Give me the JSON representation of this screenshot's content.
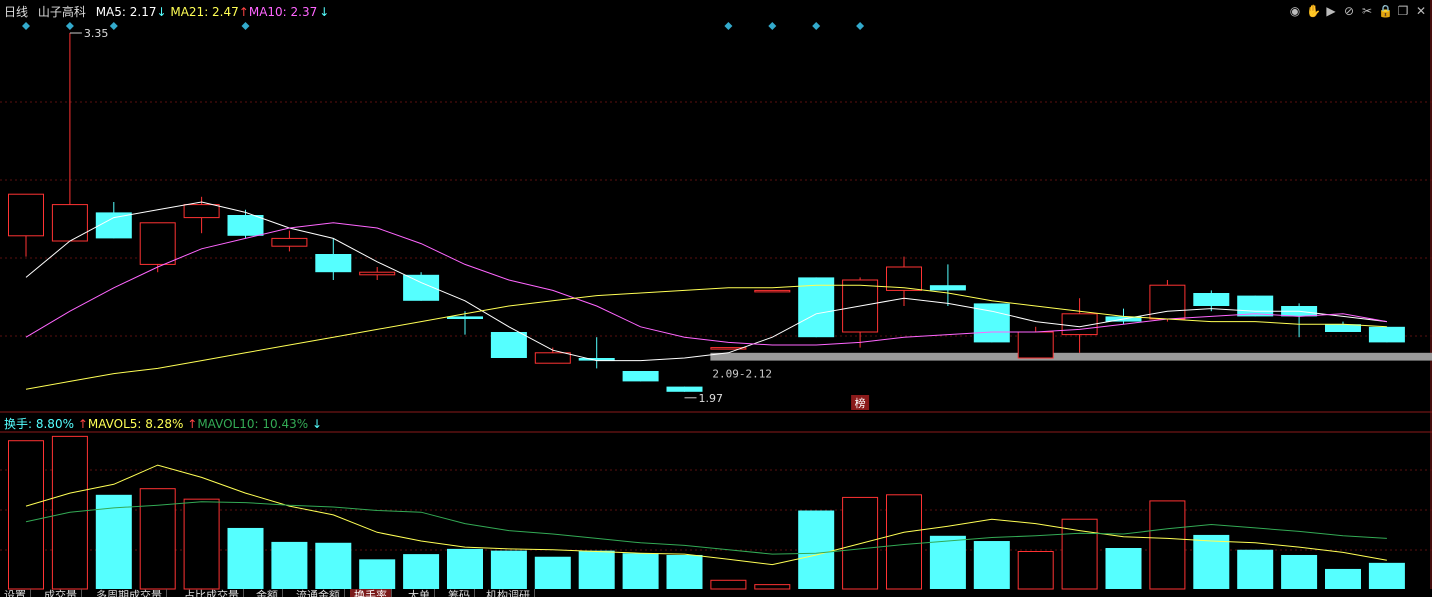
{
  "header": {
    "period": "日线",
    "stock_name": "山子高科",
    "ma5": {
      "label": "MA5: 2.17",
      "arrow": "↓",
      "color": "#ffffff"
    },
    "ma21": {
      "label": "MA21: 2.47",
      "arrow": "↑",
      "color": "#ffff55"
    },
    "ma10": {
      "label": "MA10: 2.37",
      "arrow": "↓",
      "color": "#ff66ff"
    }
  },
  "volume_header": {
    "turnover": {
      "label": "换手: 8.80%",
      "arrow": "↑",
      "color": "#55ffff"
    },
    "mavol5": {
      "label": "MAVOL5: 8.28%",
      "arrow": "↑",
      "color": "#ffff55"
    },
    "mavol10": {
      "label": "MAVOL10: 10.43%",
      "arrow": "↓",
      "color": "#33aa55"
    }
  },
  "annotations": {
    "high_label": "3.35",
    "low_label": "1.97",
    "range_label": "2.09-2.12",
    "bang_label": "榜"
  },
  "toolbar_icons": [
    "eye-icon",
    "hand-icon",
    "play-icon",
    "ban-icon",
    "scissors-icon",
    "lock-icon",
    "restore-icon",
    "close-icon"
  ],
  "tabs": [
    {
      "label": "设置",
      "active": false
    },
    {
      "label": "成交量",
      "active": false
    },
    {
      "label": "多周期成交量",
      "active": false
    },
    {
      "label": "占比成交量",
      "active": false
    },
    {
      "label": "金额",
      "active": false
    },
    {
      "label": "流通金额",
      "active": false
    },
    {
      "label": "换手率",
      "active": true
    },
    {
      "label": "大单",
      "active": false
    },
    {
      "label": "筹码",
      "active": false
    },
    {
      "label": "机构调研",
      "active": false
    }
  ],
  "colors": {
    "up": "#ff3333",
    "down": "#55ffff",
    "background": "#000000",
    "grid": "#5a1010"
  },
  "chart_data": [
    {
      "type": "candlestick",
      "title": "",
      "ylim": [
        1.9,
        3.4
      ],
      "candles": [
        {
          "open": 2.57,
          "high": 2.73,
          "low": 2.49,
          "close": 2.73
        },
        {
          "open": 2.55,
          "high": 3.35,
          "low": 2.55,
          "close": 2.69
        },
        {
          "open": 2.66,
          "high": 2.7,
          "low": 2.56,
          "close": 2.56
        },
        {
          "open": 2.46,
          "high": 2.62,
          "low": 2.43,
          "close": 2.62
        },
        {
          "open": 2.64,
          "high": 2.72,
          "low": 2.58,
          "close": 2.69
        },
        {
          "open": 2.65,
          "high": 2.67,
          "low": 2.56,
          "close": 2.57
        },
        {
          "open": 2.53,
          "high": 2.59,
          "low": 2.51,
          "close": 2.56
        },
        {
          "open": 2.5,
          "high": 2.56,
          "low": 2.4,
          "close": 2.43
        },
        {
          "open": 2.42,
          "high": 2.45,
          "low": 2.4,
          "close": 2.43
        },
        {
          "open": 2.42,
          "high": 2.43,
          "low": 2.32,
          "close": 2.32
        },
        {
          "open": 2.26,
          "high": 2.28,
          "low": 2.19,
          "close": 2.25
        },
        {
          "open": 2.2,
          "high": 2.2,
          "low": 2.1,
          "close": 2.1
        },
        {
          "open": 2.08,
          "high": 2.14,
          "low": 2.08,
          "close": 2.12
        },
        {
          "open": 2.1,
          "high": 2.18,
          "low": 2.06,
          "close": 2.09
        },
        {
          "open": 2.05,
          "high": 2.05,
          "low": 2.01,
          "close": 2.01
        },
        {
          "open": 1.99,
          "high": 1.99,
          "low": 1.97,
          "close": 1.97
        },
        {
          "open": 2.14,
          "high": 2.14,
          "low": 2.14,
          "close": 2.14
        },
        {
          "open": 2.36,
          "high": 2.36,
          "low": 2.36,
          "close": 2.36
        },
        {
          "open": 2.41,
          "high": 2.41,
          "low": 2.18,
          "close": 2.18
        },
        {
          "open": 2.2,
          "high": 2.41,
          "low": 2.14,
          "close": 2.4
        },
        {
          "open": 2.36,
          "high": 2.49,
          "low": 2.3,
          "close": 2.45
        },
        {
          "open": 2.38,
          "high": 2.46,
          "low": 2.3,
          "close": 2.36
        },
        {
          "open": 2.31,
          "high": 2.31,
          "low": 2.16,
          "close": 2.16
        },
        {
          "open": 2.1,
          "high": 2.22,
          "low": 2.1,
          "close": 2.2
        },
        {
          "open": 2.19,
          "high": 2.33,
          "low": 2.12,
          "close": 2.27
        },
        {
          "open": 2.26,
          "high": 2.29,
          "low": 2.23,
          "close": 2.24
        },
        {
          "open": 2.25,
          "high": 2.4,
          "low": 2.24,
          "close": 2.38
        },
        {
          "open": 2.35,
          "high": 2.36,
          "low": 2.28,
          "close": 2.3
        },
        {
          "open": 2.34,
          "high": 2.34,
          "low": 2.26,
          "close": 2.26
        },
        {
          "open": 2.3,
          "high": 2.31,
          "low": 2.18,
          "close": 2.26
        },
        {
          "open": 2.23,
          "high": 2.24,
          "low": 2.2,
          "close": 2.2
        },
        {
          "open": 2.22,
          "high": 2.22,
          "low": 2.16,
          "close": 2.16
        }
      ],
      "series": [
        {
          "name": "MA5",
          "color": "#ffffff",
          "values": [
            2.41,
            2.55,
            2.64,
            2.67,
            2.7,
            2.66,
            2.6,
            2.56,
            2.47,
            2.39,
            2.32,
            2.22,
            2.13,
            2.09,
            2.09,
            2.1,
            2.12,
            2.18,
            2.27,
            2.3,
            2.33,
            2.31,
            2.28,
            2.24,
            2.22,
            2.25,
            2.28,
            2.29,
            2.28,
            2.28,
            2.26,
            2.24
          ]
        },
        {
          "name": "MA10",
          "color": "#ff66ff",
          "values": [
            2.18,
            2.28,
            2.37,
            2.45,
            2.52,
            2.56,
            2.6,
            2.62,
            2.6,
            2.54,
            2.46,
            2.4,
            2.36,
            2.3,
            2.22,
            2.18,
            2.16,
            2.15,
            2.15,
            2.16,
            2.18,
            2.19,
            2.2,
            2.2,
            2.21,
            2.23,
            2.25,
            2.26,
            2.27,
            2.26,
            2.27,
            2.24
          ]
        },
        {
          "name": "MA21",
          "color": "#ffff55",
          "values": [
            1.98,
            2.01,
            2.04,
            2.06,
            2.09,
            2.12,
            2.15,
            2.18,
            2.21,
            2.24,
            2.27,
            2.3,
            2.32,
            2.34,
            2.35,
            2.36,
            2.37,
            2.37,
            2.38,
            2.38,
            2.37,
            2.35,
            2.32,
            2.3,
            2.28,
            2.26,
            2.25,
            2.24,
            2.24,
            2.23,
            2.23,
            2.22
          ]
        }
      ],
      "support_band": {
        "from": 2.09,
        "to": 2.12,
        "start_index": 16
      }
    },
    {
      "type": "bar",
      "ylim": [
        0,
        18
      ],
      "values": [
        17.0,
        17.5,
        10.8,
        11.5,
        10.3,
        7.0,
        5.4,
        5.3,
        3.4,
        4.0,
        4.6,
        4.4,
        3.7,
        4.4,
        4.1,
        3.9,
        1.0,
        0.5,
        9.0,
        10.5,
        10.8,
        6.1,
        5.5,
        4.3,
        8.0,
        4.7,
        10.1,
        6.2,
        4.5,
        3.9,
        2.3,
        3.0
      ],
      "up": [
        true,
        true,
        false,
        true,
        true,
        false,
        false,
        false,
        false,
        false,
        false,
        false,
        false,
        false,
        false,
        false,
        true,
        true,
        false,
        true,
        true,
        false,
        false,
        true,
        true,
        false,
        true,
        false,
        false,
        false,
        false,
        false
      ],
      "series": [
        {
          "name": "MAVOL5",
          "color": "#ffff55",
          "values": [
            9.5,
            11.0,
            12.0,
            14.2,
            12.8,
            11.0,
            9.5,
            8.5,
            6.5,
            5.5,
            4.8,
            4.6,
            4.5,
            4.3,
            4.1,
            4.0,
            3.4,
            2.8,
            3.9,
            5.2,
            6.5,
            7.2,
            8.0,
            7.5,
            6.7,
            6.0,
            5.8,
            5.5,
            5.3,
            4.8,
            4.2,
            3.3
          ]
        },
        {
          "name": "MAVOL10",
          "color": "#33aa55",
          "values": [
            7.7,
            8.8,
            9.3,
            9.6,
            10.0,
            9.9,
            9.6,
            9.4,
            9.0,
            8.8,
            7.5,
            6.7,
            6.3,
            5.8,
            5.3,
            5.0,
            4.5,
            4.0,
            4.1,
            4.6,
            5.1,
            5.5,
            5.9,
            6.1,
            6.4,
            6.3,
            6.9,
            7.4,
            7.0,
            6.6,
            6.1,
            5.8
          ]
        }
      ]
    }
  ]
}
